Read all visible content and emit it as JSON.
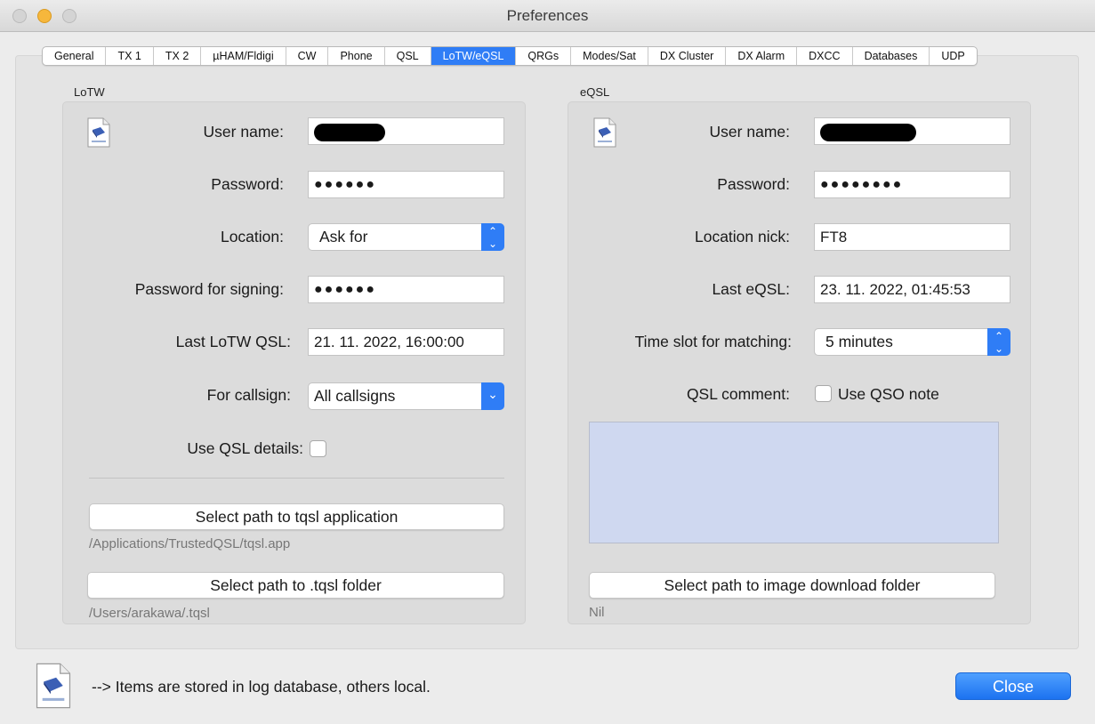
{
  "window": {
    "title": "Preferences"
  },
  "tabs": [
    "General",
    "TX 1",
    "TX 2",
    "µHAM/Fldigi",
    "CW",
    "Phone",
    "QSL",
    "LoTW/eQSL",
    "QRGs",
    "Modes/Sat",
    "DX Cluster",
    "DX Alarm",
    "DXCC",
    "Databases",
    "UDP"
  ],
  "active_tab": "LoTW/eQSL",
  "lotw": {
    "group_title": "LoTW",
    "user_name_label": "User name:",
    "password_label": "Password:",
    "password_value": "●●●●●●",
    "location_label": "Location:",
    "location_value": "Ask for",
    "signing_label": "Password for signing:",
    "signing_value": "●●●●●●",
    "last_qsl_label": "Last LoTW QSL:",
    "last_qsl_value": "21. 11. 2022,  16:00:00",
    "callsign_label": "For callsign:",
    "callsign_value": "All callsigns",
    "use_details_label": "Use QSL details:",
    "tqsl_app_button": "Select path to tqsl application",
    "tqsl_app_path": "/Applications/TrustedQSL/tqsl.app",
    "tqsl_folder_button": "Select path to .tqsl folder",
    "tqsl_folder_path": "/Users/arakawa/.tqsl"
  },
  "eqsl": {
    "group_title": "eQSL",
    "user_name_label": "User name:",
    "password_label": "Password:",
    "password_value": "●●●●●●●●",
    "location_nick_label": "Location nick:",
    "location_nick_value": "FT8",
    "last_eqsl_label": "Last eQSL:",
    "last_eqsl_value": "23. 11. 2022,  01:45:53",
    "time_slot_label": "Time slot for matching:",
    "time_slot_value": "5 minutes",
    "qsl_comment_label": "QSL comment:",
    "use_qso_note_label": "Use QSO note",
    "image_folder_button": "Select path to image download folder",
    "image_folder_path": "Nil"
  },
  "footer": {
    "note": "--> Items are stored in log database, others local.",
    "close_button": "Close"
  },
  "colors": {
    "accent": "#2f7df6",
    "comment_area": "#cfd8f0"
  }
}
